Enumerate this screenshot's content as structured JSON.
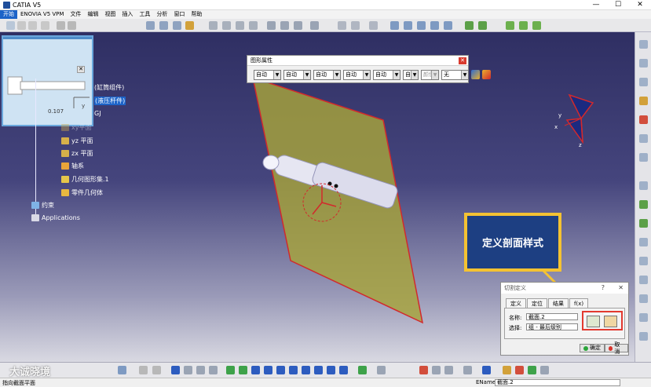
{
  "window": {
    "title": "CATIA V5",
    "controls": [
      "—",
      "☐",
      "✕"
    ]
  },
  "menu": {
    "items": [
      "开始",
      "ENOVIA V5 VPM",
      "文件",
      "编辑",
      "视图",
      "插入",
      "工具",
      "分析",
      "窗口",
      "帮助"
    ]
  },
  "preview": {
    "value": "0.107",
    "axis_label": "y",
    "close": "✕"
  },
  "tree": {
    "items": [
      {
        "label": "(缸筒组件)"
      },
      {
        "label": "(液压杆件)"
      },
      {
        "label": "GJ"
      },
      {
        "label": "xy平面"
      },
      {
        "label": "yz 平面"
      },
      {
        "label": "zx 平面"
      },
      {
        "label": "轴系"
      },
      {
        "label": "几何图形集.1"
      },
      {
        "label": "零件几何体"
      },
      {
        "label": "约束"
      },
      {
        "label": "Applications"
      }
    ]
  },
  "graphic_properties": {
    "title": "图形属性",
    "close": "✕",
    "combos": [
      {
        "value": "自动",
        "enabled": true
      },
      {
        "value": "自动",
        "enabled": true
      },
      {
        "value": "自动",
        "enabled": true
      },
      {
        "value": "自动",
        "enabled": true
      },
      {
        "value": "自动",
        "enabled": true
      },
      {
        "value": "自动",
        "enabled": true
      },
      {
        "value": "颜色",
        "enabled": false
      },
      {
        "value": "无",
        "enabled": true
      }
    ]
  },
  "callout": {
    "text": "定义剖面样式"
  },
  "section_dialog": {
    "title": "切割定义",
    "help": "?",
    "close": "✕",
    "tabs": [
      "定义",
      "定位",
      "结果",
      "f(x)"
    ],
    "name_label": "名称:",
    "name_value": "截面.2",
    "select_label": "选择:",
    "select_value": "组 - 最后级别",
    "ok_label": "确定",
    "cancel_label": "取消"
  },
  "watermark": "大诚晓境",
  "status": {
    "left": "指向截面平面",
    "right_label": "EName",
    "right_value": "截面.2"
  },
  "compass": {
    "labels": [
      "y",
      "x",
      "z"
    ]
  },
  "colors": {
    "plane_fill": "#a7a33a",
    "plane_edge": "#d2292c",
    "callout_border": "#f4c232",
    "callout_fill": "#1d3f82",
    "highlight": "#e23a2f"
  }
}
